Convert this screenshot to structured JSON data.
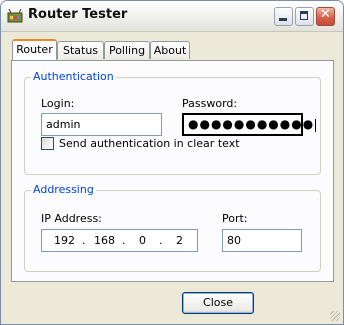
{
  "window": {
    "title": "Router Tester"
  },
  "tabs": [
    {
      "label": "Router",
      "active": true
    },
    {
      "label": "Status",
      "active": false
    },
    {
      "label": "Polling",
      "active": false
    },
    {
      "label": "About",
      "active": false
    }
  ],
  "authentication": {
    "legend": "Authentication",
    "login_label": "Login:",
    "login_value": "admin",
    "password_label": "Password:",
    "password_masked": "●●●●●●●●●●●",
    "cleartext_label": "Send authentication in clear text",
    "cleartext_checked": false
  },
  "addressing": {
    "legend": "Addressing",
    "ip_label": "IP Address:",
    "ip": [
      "192",
      "168",
      "0",
      "2"
    ],
    "ip_separator": ".",
    "port_label": "Port:",
    "port_value": "80"
  },
  "footer": {
    "close_label": "Close"
  },
  "colors": {
    "legend_text": "#0046d5",
    "active_tab_accent": "#e68b2c",
    "window_face": "#ece9d8"
  }
}
